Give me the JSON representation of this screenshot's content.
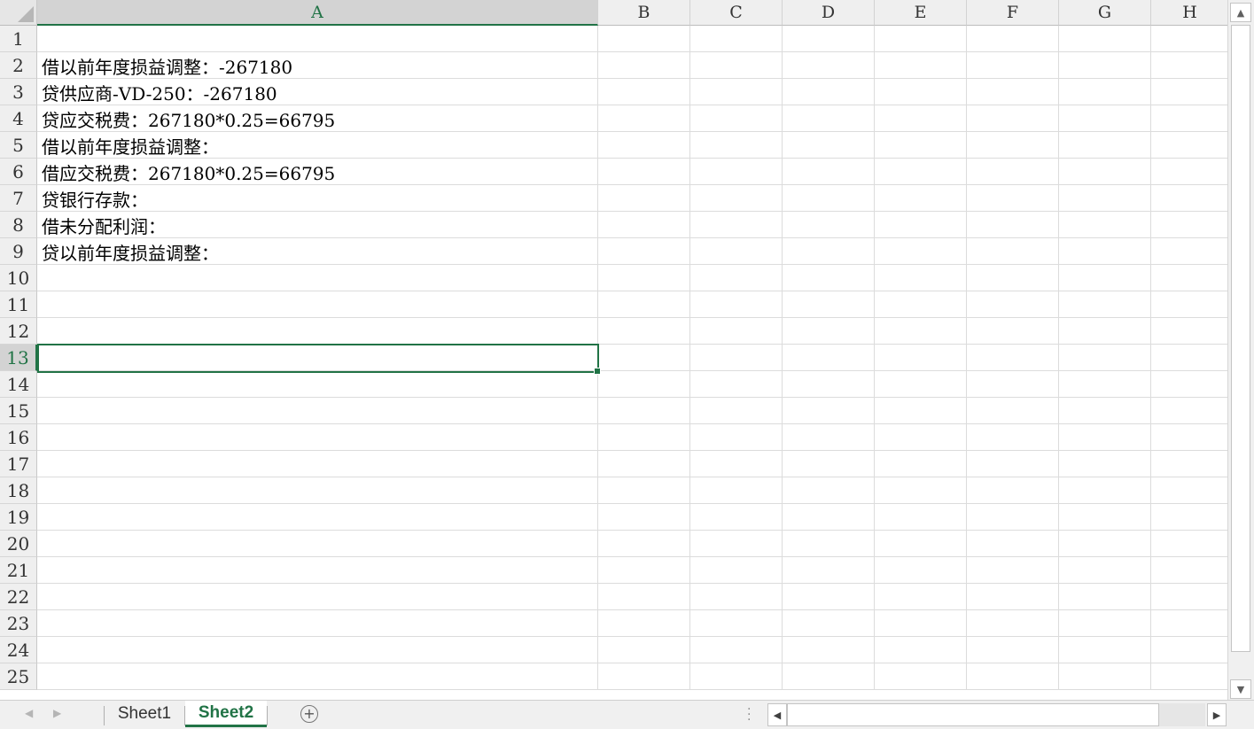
{
  "sheet": {
    "columns": [
      "A",
      "B",
      "C",
      "D",
      "E",
      "F",
      "G",
      "H"
    ],
    "selected_column": "A",
    "selected_row": 13,
    "rows": [
      "1",
      "2",
      "3",
      "4",
      "5",
      "6",
      "7",
      "8",
      "9",
      "10",
      "11",
      "12",
      "13",
      "14",
      "15",
      "16",
      "17",
      "18",
      "19",
      "20",
      "21",
      "22",
      "23",
      "24",
      "25"
    ],
    "col_a_values": [
      "",
      "借以前年度损益调整：-267180",
      "贷供应商-VD-250：-267180",
      "贷应交税费：267180*0.25=66795",
      "借以前年度损益调整：",
      "借应交税费：267180*0.25=66795",
      "贷银行存款：",
      "借未分配利润：",
      "贷以前年度损益调整：",
      "",
      "",
      "",
      "",
      "",
      "",
      "",
      "",
      "",
      "",
      "",
      "",
      "",
      "",
      "",
      ""
    ]
  },
  "tabs": [
    {
      "label": "Sheet1",
      "active": false
    },
    {
      "label": "Sheet2",
      "active": true
    }
  ],
  "icons": {
    "add_sheet": "plus-circle-icon",
    "scroll_up": "triangle-up-icon",
    "scroll_down": "triangle-down-icon",
    "scroll_left": "triangle-left-icon",
    "scroll_right": "triangle-right-icon"
  },
  "colors": {
    "accent": "#217346"
  }
}
